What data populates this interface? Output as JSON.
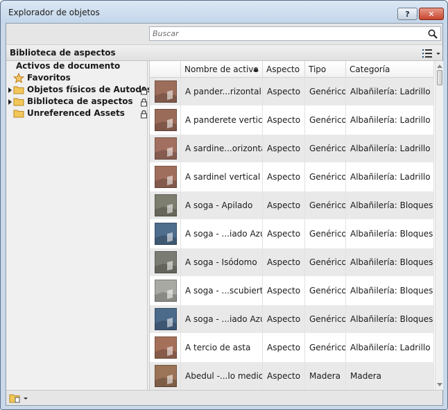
{
  "window": {
    "title": "Explorador de objetos",
    "help_label": "?",
    "close_label": "✕"
  },
  "search": {
    "placeholder": "Buscar",
    "icon": "magnifier"
  },
  "section": {
    "title": "Biblioteca de aspectos",
    "view_icon": "list-view"
  },
  "tree": {
    "root": "Activos de documento",
    "items": [
      {
        "label": "Favoritos",
        "icon": "star",
        "expander": false,
        "locked": false
      },
      {
        "label": "Objetos físicos de Autodesk",
        "icon": "folder",
        "expander": true,
        "locked": true
      },
      {
        "label": "Biblioteca de aspectos",
        "icon": "folder",
        "expander": true,
        "locked": true
      },
      {
        "label": "Unreferenced Assets",
        "icon": "folder",
        "expander": false,
        "locked": true
      }
    ]
  },
  "grid": {
    "columns": [
      "",
      "Nombre de activo",
      "Aspecto",
      "Tipo",
      "Categoría"
    ],
    "sort_column": "Nombre de activo",
    "sort_direction": "ascending",
    "rows": [
      {
        "name": "A pander...rizontal",
        "aspect": "Aspecto",
        "type": "Genérico",
        "category": "Albañilería: Ladrillo",
        "swatch": "#9c6d5b"
      },
      {
        "name": "A panderete vertical",
        "aspect": "Aspecto",
        "type": "Genérico",
        "category": "Albañilería: Ladrillo",
        "swatch": "#9a6b59"
      },
      {
        "name": "A sardine...orizontal",
        "aspect": "Aspecto",
        "type": "Genérico",
        "category": "Albañilería: Ladrillo",
        "swatch": "#a27060"
      },
      {
        "name": "A sardinel vertical",
        "aspect": "Aspecto",
        "type": "Genérico",
        "category": "Albañilería: Ladrillo",
        "swatch": "#a06e5d"
      },
      {
        "name": "A soga - Apilado",
        "aspect": "Aspecto",
        "type": "Genérico",
        "category": "Albañilería: Bloques ...",
        "swatch": "#7d7d70"
      },
      {
        "name": "A soga - ...iado Azul",
        "aspect": "Aspecto",
        "type": "Genérico",
        "category": "Albañilería: Bloques ...",
        "swatch": "#4f6d8c"
      },
      {
        "name": "A soga - Isódomo",
        "aspect": "Aspecto",
        "type": "Genérico",
        "category": "Albañilería: Bloques ...",
        "swatch": "#7a7b72"
      },
      {
        "name": "A soga - ...scubierto",
        "aspect": "Aspecto",
        "type": "Genérico",
        "category": "Albañilería: Bloques ...",
        "swatch": "#a9a9a3"
      },
      {
        "name": "A soga - ...iado Azul",
        "aspect": "Aspecto",
        "type": "Genérico",
        "category": "Albañilería: Bloques ...",
        "swatch": "#4c6a8a"
      },
      {
        "name": "A tercio de asta",
        "aspect": "Aspecto",
        "type": "Genérico",
        "category": "Albañilería: Ladrillo",
        "swatch": "#a5705a"
      },
      {
        "name": "Abedul -...lo medio",
        "aspect": "Aspecto",
        "type": "Madera",
        "category": "Madera",
        "swatch": "#9b7357"
      }
    ]
  },
  "statusbar": {
    "icon": "library-manager"
  }
}
